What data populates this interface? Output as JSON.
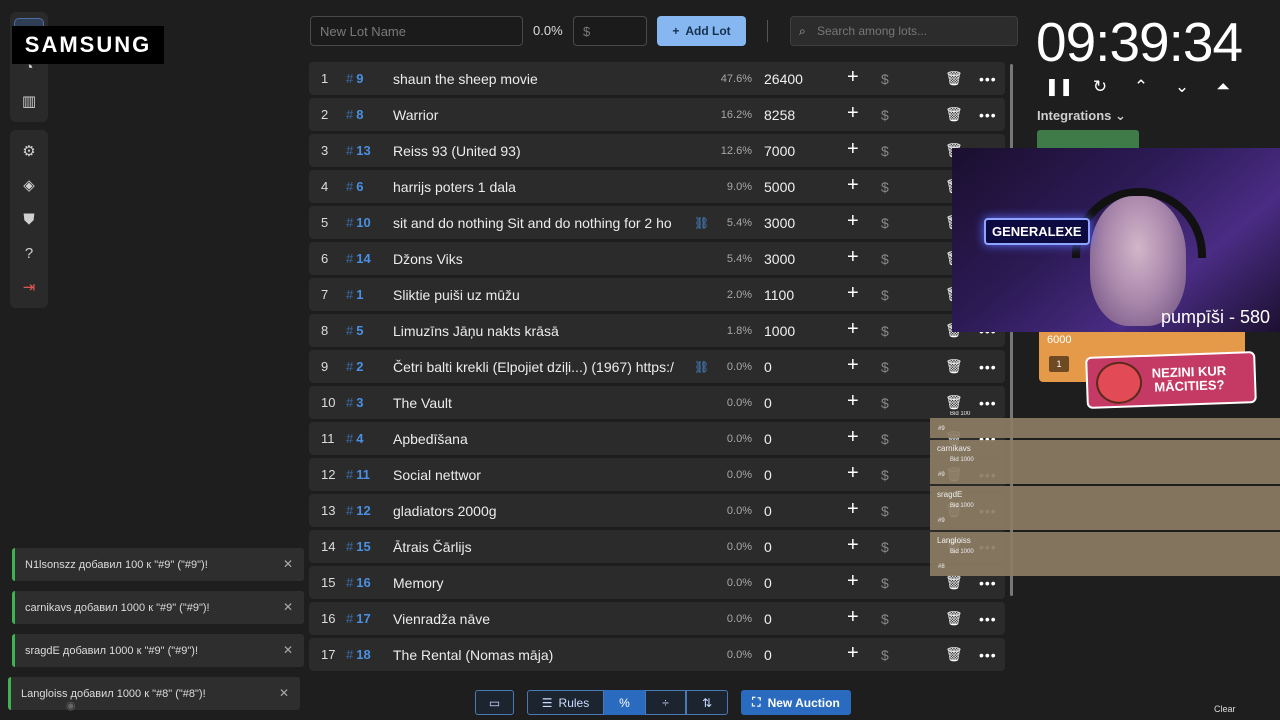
{
  "brand": {
    "overlay_logo": "SAMSUNG"
  },
  "topbar": {
    "lot_name_placeholder": "New Lot Name",
    "percent": "0.0%",
    "amount_placeholder": "$",
    "add_lot_label": "Add Lot",
    "search_placeholder": "Search among lots..."
  },
  "lots": [
    {
      "rank": "1",
      "id": "9",
      "name": "shaun the sheep movie",
      "link": false,
      "percent": "47.6%",
      "amount": "26400"
    },
    {
      "rank": "2",
      "id": "8",
      "name": "Warrior",
      "link": false,
      "percent": "16.2%",
      "amount": "8258"
    },
    {
      "rank": "3",
      "id": "13",
      "name": "Reiss 93 (United 93)",
      "link": false,
      "percent": "12.6%",
      "amount": "7000"
    },
    {
      "rank": "4",
      "id": "6",
      "name": "harrijs poters 1 dala",
      "link": false,
      "percent": "9.0%",
      "amount": "5000"
    },
    {
      "rank": "5",
      "id": "10",
      "name": "sit and do nothing Sit and do nothing for 2 ho",
      "link": true,
      "percent": "5.4%",
      "amount": "3000"
    },
    {
      "rank": "6",
      "id": "14",
      "name": "Džons Viks",
      "link": false,
      "percent": "5.4%",
      "amount": "3000"
    },
    {
      "rank": "7",
      "id": "1",
      "name": "Sliktie puiši uz mūžu",
      "link": false,
      "percent": "2.0%",
      "amount": "1100"
    },
    {
      "rank": "8",
      "id": "5",
      "name": "Limuzīns Jāņu nakts krāsā",
      "link": false,
      "percent": "1.8%",
      "amount": "1000"
    },
    {
      "rank": "9",
      "id": "2",
      "name": "Četri balti krekli (Elpojiet dziļi...) (1967) https:/",
      "link": true,
      "percent": "0.0%",
      "amount": "0"
    },
    {
      "rank": "10",
      "id": "3",
      "name": "The Vault",
      "link": false,
      "percent": "0.0%",
      "amount": "0"
    },
    {
      "rank": "11",
      "id": "4",
      "name": "Apbedīšana",
      "link": false,
      "percent": "0.0%",
      "amount": "0"
    },
    {
      "rank": "12",
      "id": "11",
      "name": "Social nettwor",
      "link": false,
      "percent": "0.0%",
      "amount": "0"
    },
    {
      "rank": "13",
      "id": "12",
      "name": "gladiators 2000g",
      "link": false,
      "percent": "0.0%",
      "amount": "0"
    },
    {
      "rank": "14",
      "id": "15",
      "name": "Ātrais Čārlijs",
      "link": false,
      "percent": "0.0%",
      "amount": "0"
    },
    {
      "rank": "15",
      "id": "16",
      "name": "Memory",
      "link": false,
      "percent": "0.0%",
      "amount": "0"
    },
    {
      "rank": "16",
      "id": "17",
      "name": "Vienradža nāve",
      "link": false,
      "percent": "0.0%",
      "amount": "0"
    },
    {
      "rank": "17",
      "id": "18",
      "name": "The Rental (Nomas māja)",
      "link": false,
      "percent": "0.0%",
      "amount": "0"
    }
  ],
  "timer": {
    "value": "09:39:34"
  },
  "integrations": {
    "label": "Integrations"
  },
  "webcam": {
    "sign_text": "GENERALEXE",
    "caption": "pumpīši - 580"
  },
  "bid_popup": {
    "amount": "6000",
    "badge": "1"
  },
  "ad": {
    "text_line1": "NEZINI KUR",
    "text_line2": "MĀCITIES?"
  },
  "donations": [
    {
      "user": "",
      "bid": "Bid 100",
      "lot": "#9"
    },
    {
      "user": "carnikavs",
      "bid": "Bid 1000",
      "lot": "#9"
    },
    {
      "user": "sragdE",
      "bid": "Bid 1000",
      "lot": "#9"
    },
    {
      "user": "Langloiss",
      "bid": "Bid 1000",
      "lot": "#8"
    }
  ],
  "notifications": [
    {
      "text": "N1lsonszz добавил 100 к \"#9\" (\"#9\")!"
    },
    {
      "text": "carnikavs добавил 1000 к \"#9\" (\"#9\")!"
    },
    {
      "text": "sragdE добавил 1000 к \"#9\" (\"#9\")!"
    },
    {
      "text": "Langloiss добавил 1000 к \"#8\" (\"#8\")!"
    }
  ],
  "bottom": {
    "rules_label": "Rules",
    "new_auction_label": "New Auction",
    "clear_label": "Clear"
  },
  "colors": {
    "accent": "#2a6bbf",
    "lot_id": "#4a90e2",
    "add_lot_bg": "#87b7f0",
    "notif_border": "#3fb34f"
  }
}
